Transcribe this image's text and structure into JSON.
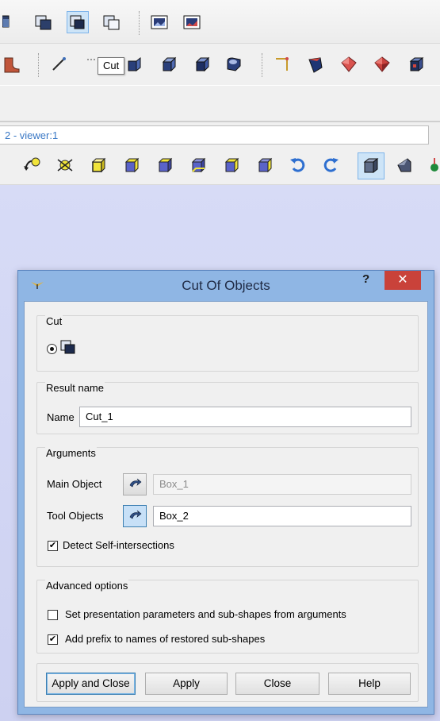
{
  "tooltip": "Cut",
  "viewer_tab": {
    "label": "2 - viewer:1"
  },
  "dialog": {
    "title": "Cut Of Objects",
    "help_glyph": "?",
    "close_glyph": "✕",
    "cut_group": {
      "title": "Cut"
    },
    "result_group": {
      "title": "Result name",
      "name_label": "Name",
      "name_value": "Cut_1"
    },
    "arguments_group": {
      "title": "Arguments",
      "main_object_label": "Main Object",
      "main_object_value": "Box_1",
      "tool_objects_label": "Tool Objects",
      "tool_objects_value": "Box_2",
      "detect_label": "Detect Self-intersections",
      "detect_checked": true
    },
    "advanced_group": {
      "title": "Advanced options",
      "presentation_label": "Set presentation parameters and sub-shapes from arguments",
      "presentation_checked": false,
      "prefix_label": "Add prefix to names of restored sub-shapes",
      "prefix_checked": true
    },
    "buttons": {
      "apply_close": "Apply and Close",
      "apply": "Apply",
      "close": "Close",
      "help": "Help"
    }
  },
  "colors": {
    "accent": "#3c7fb1",
    "close_button": "#c9423a",
    "viewport": "#d7dbf6",
    "solid_yellow": "#f1e43a",
    "solid_purple": "#5a63c9"
  },
  "icons": {
    "toolbar1": [
      "boolean-common-icon",
      "boolean-cut-icon",
      "boolean-cut-active-icon",
      "boolean-fuse-icon",
      "image-icon",
      "image-2-icon"
    ],
    "toolbar2": [
      "fillet-icon",
      "line-icon",
      "cut-tool-icon",
      "extrusion-icon",
      "revolution-icon",
      "pipe-icon",
      "edge-icon",
      "face-icon",
      "shell-icon",
      "solid-icon",
      "compound-icon"
    ],
    "viewer": [
      "pan-icon",
      "rotate-icon",
      "view-front-icon",
      "view-back-icon",
      "view-top-icon",
      "view-bottom-icon",
      "view-left-icon",
      "view-right-icon",
      "view-iso-icon",
      "rotate-ccw-icon",
      "rotate-cw-icon",
      "shading-icon",
      "wireframe-icon",
      "trihedron-icon"
    ]
  }
}
